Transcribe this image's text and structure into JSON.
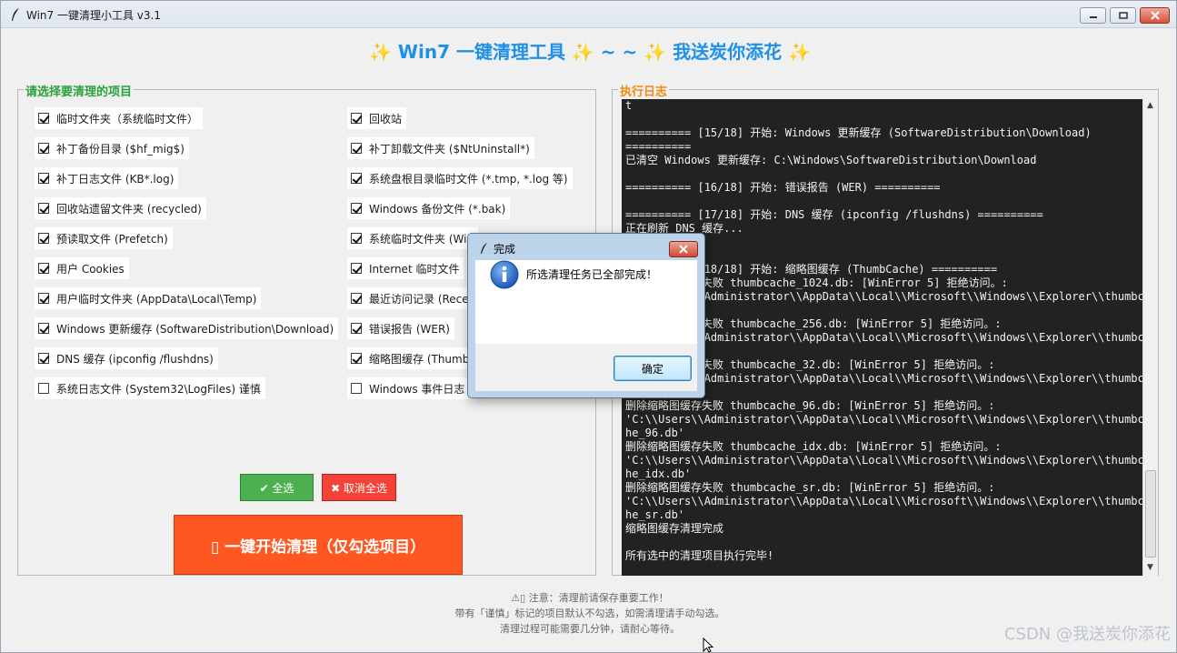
{
  "window": {
    "title": "Win7 一键清理小工具 v3.1"
  },
  "banner": "✨ Win7 一键清理工具 ✨ ~ ~ ✨ 我送炭你添花 ✨",
  "left_group": {
    "legend": "请选择要清理的项目",
    "col1": [
      {
        "label": "临时文件夹（系统临时文件）",
        "checked": true
      },
      {
        "label": "补丁备份目录 ($hf_mig$)",
        "checked": true
      },
      {
        "label": "补丁日志文件 (KB*.log)",
        "checked": true
      },
      {
        "label": "回收站遗留文件夹 (recycled)",
        "checked": true
      },
      {
        "label": "预读取文件 (Prefetch)",
        "checked": true
      },
      {
        "label": "用户 Cookies",
        "checked": true
      },
      {
        "label": "用户临时文件夹 (AppData\\Local\\Temp)",
        "checked": true
      },
      {
        "label": "Windows 更新缓存 (SoftwareDistribution\\Download)",
        "checked": true
      },
      {
        "label": "DNS 缓存 (ipconfig /flushdns)",
        "checked": true
      },
      {
        "label": "系统日志文件 (System32\\LogFiles) 谨慎",
        "checked": false
      }
    ],
    "col2": [
      {
        "label": "回收站",
        "checked": true
      },
      {
        "label": "补丁卸载文件夹 ($NtUninstall*)",
        "checked": true
      },
      {
        "label": "系统盘根目录临时文件 (*.tmp, *.log 等)",
        "checked": true
      },
      {
        "label": "Windows 备份文件 (*.bak)",
        "checked": true
      },
      {
        "label": "系统临时文件夹 (Win",
        "checked": true
      },
      {
        "label": "Internet 临时文件",
        "checked": true
      },
      {
        "label": "最近访问记录 (Rece",
        "checked": true
      },
      {
        "label": "错误报告 (WER)",
        "checked": true
      },
      {
        "label": "缩略图缓存 (Thumb",
        "checked": true
      },
      {
        "label": "Windows 事件日志",
        "checked": false
      }
    ],
    "select_all_label": "✔ 全选",
    "deselect_all_label": "✖ 取消全选",
    "start_label": "▯ 一键开始清理（仅勾选项目）"
  },
  "right_group": {
    "legend": "执行日志",
    "log_lines": [
      "t",
      "",
      "========== [15/18] 开始: Windows 更新缓存 (SoftwareDistribution\\Download)",
      "==========",
      "已清空 Windows 更新缓存: C:\\Windows\\SoftwareDistribution\\Download",
      "",
      "========== [16/18] 开始: 错误报告 (WER) ==========",
      "",
      "========== [17/18] 开始: DNS 缓存 (ipconfig /flushdns) ==========",
      "正在刷新 DNS 缓存...",
      "",
      "",
      "========== [18/18] 开始: 缩略图缓存 (ThumbCache) ==========",
      "删除缩略图缓存失败 thumbcache_1024.db: [WinError 5] 拒绝访问。:",
      "'C:\\\\Users\\\\Administrator\\\\AppData\\\\Local\\\\Microsoft\\\\Windows\\\\Explorer\\\\thumbcac",
      "",
      "删除缩略图缓存失败 thumbcache_256.db: [WinError 5] 拒绝访问。:",
      "'C:\\\\Users\\\\Administrator\\\\AppData\\\\Local\\\\Microsoft\\\\Windows\\\\Explorer\\\\thumbcac",
      "",
      "删除缩略图缓存失败 thumbcache_32.db: [WinError 5] 拒绝访问。:",
      "'C:\\\\Users\\\\Administrator\\\\AppData\\\\Local\\\\Microsoft\\\\Windows\\\\Explorer\\\\thumbcac",
      "",
      "删除缩略图缓存失败 thumbcache_96.db: [WinError 5] 拒绝访问。:",
      "'C:\\\\Users\\\\Administrator\\\\AppData\\\\Local\\\\Microsoft\\\\Windows\\\\Explorer\\\\thumbcac",
      "he_96.db'",
      "删除缩略图缓存失败 thumbcache_idx.db: [WinError 5] 拒绝访问。:",
      "'C:\\\\Users\\\\Administrator\\\\AppData\\\\Local\\\\Microsoft\\\\Windows\\\\Explorer\\\\thumbcac",
      "he_idx.db'",
      "删除缩略图缓存失败 thumbcache_sr.db: [WinError 5] 拒绝访问。:",
      "'C:\\\\Users\\\\Administrator\\\\AppData\\\\Local\\\\Microsoft\\\\Windows\\\\Explorer\\\\thumbcac",
      "he_sr.db'",
      "缩略图缓存清理完成",
      "",
      "所有选中的清理项目执行完毕!"
    ]
  },
  "notes": {
    "line1": "⚠▯ 注意：清理前请保存重要工作！",
    "line2": "带有「谨慎」标记的项目默认不勾选，如需清理请手动勾选。",
    "line3": "清理过程可能需要几分钟，请耐心等待。"
  },
  "watermark": "CSDN @我送炭你添花",
  "dialog": {
    "title": "完成",
    "message": "所选清理任务已全部完成！",
    "ok_label": "确定"
  },
  "colors": {
    "banner": "#1e90e6",
    "legend_left": "#2aa13a",
    "legend_right": "#f08a12",
    "select_all": "#4caf50",
    "deselect_all": "#f44336",
    "start": "#ff5722",
    "log_bg": "#222222"
  },
  "icons": {
    "app": "feather-icon",
    "dialog_info": "info-icon"
  }
}
